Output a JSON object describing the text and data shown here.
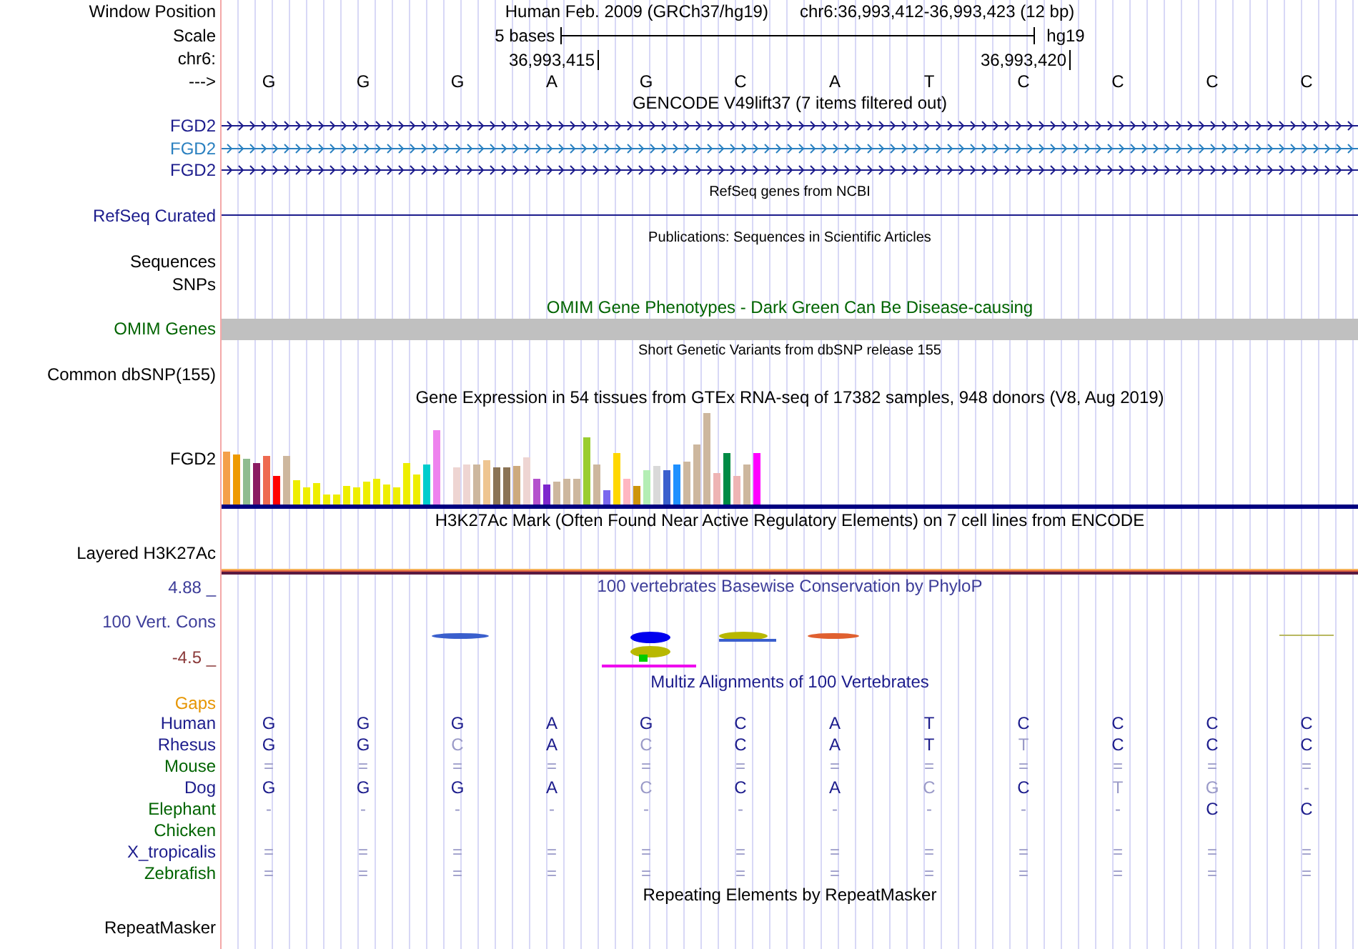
{
  "header": {
    "label": "Window Position",
    "assembly": "Human Feb. 2009 (GRCh37/hg19)",
    "position": "chr6:36,993,412-36,993,423 (12 bp)"
  },
  "scale": {
    "label": "Scale",
    "span": "5 bases",
    "assembly": "hg19"
  },
  "coordinates": {
    "label": "chr6:",
    "ticks": [
      "36,993,415",
      "36,993,420"
    ]
  },
  "sequence": {
    "label": "--->",
    "bases": [
      "G",
      "G",
      "G",
      "A",
      "G",
      "C",
      "A",
      "T",
      "C",
      "C",
      "C",
      "C"
    ]
  },
  "tracks": [
    {
      "kind": "genes",
      "title": "GENCODE V49lift37 (7 items filtered out)",
      "items": [
        {
          "name": "FGD2",
          "color": "#1c1c8c"
        },
        {
          "name": "FGD2",
          "color": "#2a80c0"
        },
        {
          "name": "FGD2",
          "color": "#1c1c8c"
        }
      ]
    },
    {
      "kind": "dense",
      "title": "RefSeq genes from NCBI",
      "items": [
        {
          "name": "RefSeq Curated",
          "color": "#1c1c8c",
          "feature": true
        }
      ]
    },
    {
      "kind": "dense",
      "title": "Publications: Sequences in Scientific Articles",
      "items": [
        {
          "name": "Sequences",
          "color": "#000000",
          "feature": false
        },
        {
          "name": "SNPs",
          "color": "#000000",
          "feature": false
        }
      ]
    },
    {
      "kind": "bar",
      "title": "OMIM Gene Phenotypes - Dark Green Can Be Disease-causing",
      "items": [
        {
          "name": "OMIM Genes",
          "color": "#006400"
        }
      ]
    },
    {
      "kind": "dense",
      "title": "Short Genetic Variants from dbSNP release 155",
      "items": [
        {
          "name": "Common dbSNP(155)",
          "color": "#000000",
          "feature": false
        }
      ]
    },
    {
      "kind": "expression",
      "title": "Gene Expression in 54 tissues from GTEx RNA-seq of 17382 samples, 948 donors (V8, Aug 2019)",
      "items": [
        {
          "name": "FGD2",
          "color": "#000000"
        }
      ]
    },
    {
      "kind": "layered",
      "title": "H3K27Ac Mark (Often Found Near Active Regulatory Elements) on 7 cell lines from ENCODE",
      "items": [
        {
          "name": "Layered H3K27Ac",
          "color": "#000000"
        }
      ]
    },
    {
      "kind": "conservation",
      "title": "100 vertebrates Basewise Conservation by PhyloP",
      "max": "4.88 _",
      "min": "-4.5 _",
      "items": [
        {
          "name": "100 Vert. Cons",
          "color": "#3d3d99"
        }
      ]
    },
    {
      "kind": "alignment",
      "title": "Multiz Alignments of 100 Vertebrates",
      "gaps": {
        "name": "Gaps",
        "color": "#e69500"
      },
      "species": [
        {
          "name": "Human",
          "color": "#1c1c8c",
          "bases": [
            {
              "b": "G",
              "faded": false
            },
            {
              "b": "G",
              "faded": false
            },
            {
              "b": "G",
              "faded": false
            },
            {
              "b": "A",
              "faded": false
            },
            {
              "b": "G",
              "faded": false
            },
            {
              "b": "C",
              "faded": false
            },
            {
              "b": "A",
              "faded": false
            },
            {
              "b": "T",
              "faded": false
            },
            {
              "b": "C",
              "faded": false
            },
            {
              "b": "C",
              "faded": false
            },
            {
              "b": "C",
              "faded": false
            },
            {
              "b": "C",
              "faded": false
            }
          ]
        },
        {
          "name": "Rhesus",
          "color": "#1c1c8c",
          "bases": [
            {
              "b": "G",
              "faded": false
            },
            {
              "b": "G",
              "faded": false
            },
            {
              "b": "C",
              "faded": true
            },
            {
              "b": "A",
              "faded": false
            },
            {
              "b": "C",
              "faded": true
            },
            {
              "b": "C",
              "faded": false
            },
            {
              "b": "A",
              "faded": false
            },
            {
              "b": "T",
              "faded": false
            },
            {
              "b": "T",
              "faded": true
            },
            {
              "b": "C",
              "faded": false
            },
            {
              "b": "C",
              "faded": false
            },
            {
              "b": "C",
              "faded": false
            }
          ]
        },
        {
          "name": "Mouse",
          "color": "#006400",
          "bases": [
            {
              "b": "=",
              "faded": true
            },
            {
              "b": "=",
              "faded": true
            },
            {
              "b": "=",
              "faded": true
            },
            {
              "b": "=",
              "faded": true
            },
            {
              "b": "=",
              "faded": true
            },
            {
              "b": "=",
              "faded": true
            },
            {
              "b": "=",
              "faded": true
            },
            {
              "b": "=",
              "faded": true
            },
            {
              "b": "=",
              "faded": true
            },
            {
              "b": "=",
              "faded": true
            },
            {
              "b": "=",
              "faded": true
            },
            {
              "b": "=",
              "faded": true
            }
          ]
        },
        {
          "name": "Dog",
          "color": "#1c1c8c",
          "bases": [
            {
              "b": "G",
              "faded": false
            },
            {
              "b": "G",
              "faded": false
            },
            {
              "b": "G",
              "faded": false
            },
            {
              "b": "A",
              "faded": false
            },
            {
              "b": "C",
              "faded": true
            },
            {
              "b": "C",
              "faded": false
            },
            {
              "b": "A",
              "faded": false
            },
            {
              "b": "C",
              "faded": true
            },
            {
              "b": "C",
              "faded": false
            },
            {
              "b": "T",
              "faded": true
            },
            {
              "b": "G",
              "faded": true
            },
            {
              "b": "-",
              "faded": true
            }
          ]
        },
        {
          "name": "Elephant",
          "color": "#006400",
          "bases": [
            {
              "b": "-",
              "faded": true
            },
            {
              "b": "-",
              "faded": true
            },
            {
              "b": "-",
              "faded": true
            },
            {
              "b": "-",
              "faded": true
            },
            {
              "b": "-",
              "faded": true
            },
            {
              "b": "-",
              "faded": true
            },
            {
              "b": "-",
              "faded": true
            },
            {
              "b": "-",
              "faded": true
            },
            {
              "b": "-",
              "faded": true
            },
            {
              "b": "-",
              "faded": true
            },
            {
              "b": "C",
              "faded": false
            },
            {
              "b": "C",
              "faded": false
            }
          ]
        },
        {
          "name": "Chicken",
          "color": "#006400"
        },
        {
          "name": "X_tropicalis",
          "color": "#1c1c8c",
          "bases": [
            {
              "b": "=",
              "faded": true
            },
            {
              "b": "=",
              "faded": true
            },
            {
              "b": "=",
              "faded": true
            },
            {
              "b": "=",
              "faded": true
            },
            {
              "b": "=",
              "faded": true
            },
            {
              "b": "=",
              "faded": true
            },
            {
              "b": "=",
              "faded": true
            },
            {
              "b": "=",
              "faded": true
            },
            {
              "b": "=",
              "faded": true
            },
            {
              "b": "=",
              "faded": true
            },
            {
              "b": "=",
              "faded": true
            },
            {
              "b": "=",
              "faded": true
            }
          ]
        },
        {
          "name": "Zebrafish",
          "color": "#006400",
          "bases": [
            {
              "b": "=",
              "faded": true
            },
            {
              "b": "=",
              "faded": true
            },
            {
              "b": "=",
              "faded": true
            },
            {
              "b": "=",
              "faded": true
            },
            {
              "b": "=",
              "faded": true
            },
            {
              "b": "=",
              "faded": true
            },
            {
              "b": "=",
              "faded": true
            },
            {
              "b": "=",
              "faded": true
            },
            {
              "b": "=",
              "faded": true
            },
            {
              "b": "=",
              "faded": true
            },
            {
              "b": "=",
              "faded": true
            },
            {
              "b": "=",
              "faded": true
            }
          ]
        }
      ]
    },
    {
      "kind": "empty",
      "title": "Repeating Elements by RepeatMasker",
      "items": [
        {
          "name": "RepeatMasker",
          "color": "#000000"
        }
      ]
    }
  ]
}
